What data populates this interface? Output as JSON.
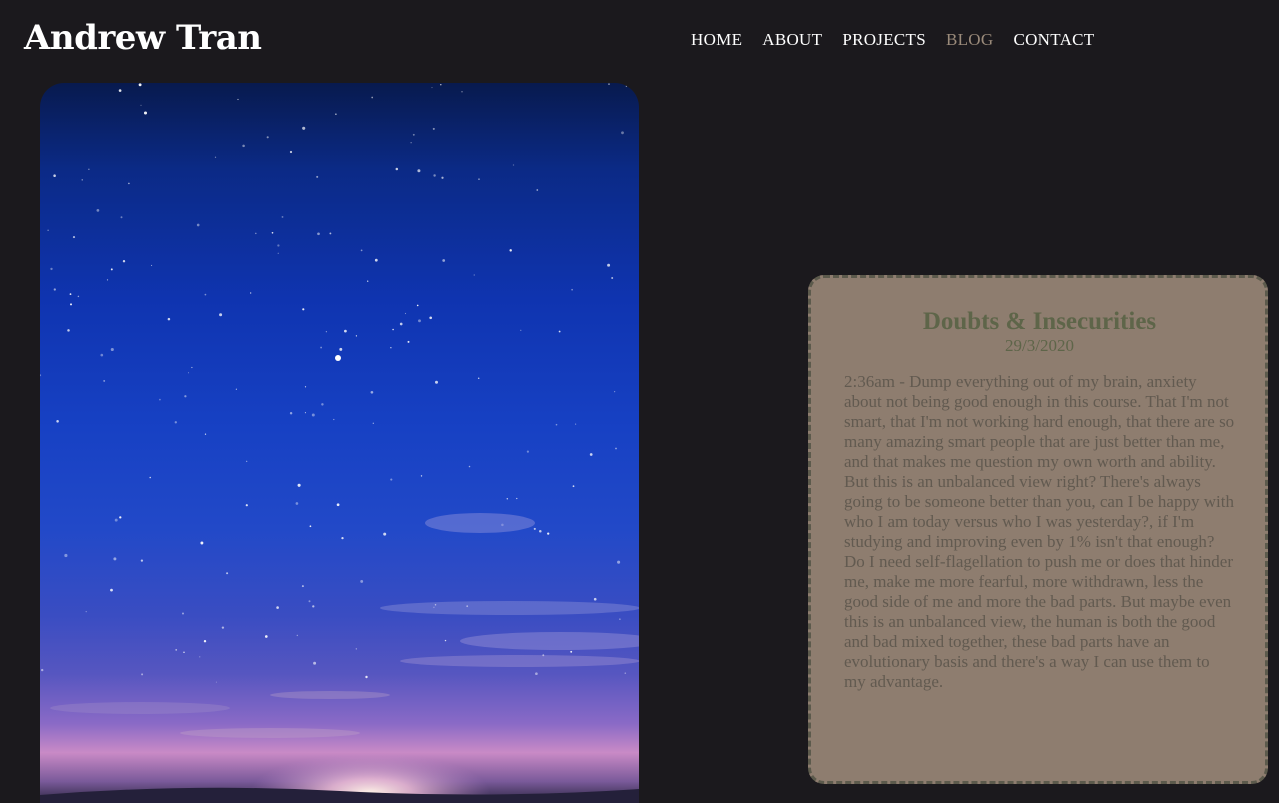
{
  "site": {
    "title": "Andrew Tran"
  },
  "nav": {
    "items": [
      {
        "label": "HOME",
        "active": false
      },
      {
        "label": "ABOUT",
        "active": false
      },
      {
        "label": "PROJECTS",
        "active": false
      },
      {
        "label": "BLOG",
        "active": true
      },
      {
        "label": "CONTACT",
        "active": false
      }
    ]
  },
  "post": {
    "title": "Doubts & Insecurities",
    "date": "29/3/2020",
    "body": "2:36am - Dump everything out of my brain, anxiety about not being good enough in this course. That I'm not smart, that I'm not working hard enough, that there are so many amazing smart people that are just better than me, and that makes me question my own worth and ability. But this is an unbalanced view right? There's always going to be someone better than you, can I be happy with who I am today versus who I was yesterday?, if I'm studying and improving even by 1% isn't that enough? Do I need self-flagellation to push me or does that hinder me, make me more fearful, more withdrawn, less the good side of me and more the bad parts. But maybe even this is an unbalanced view, the human is both the good and bad mixed together, these bad parts have an evolutionary basis and there's a way I can use them to my advantage."
  },
  "colors": {
    "background": "#1b191d",
    "nav_active": "#9a8a7a",
    "card_bg": "#8e7d6f",
    "card_border": "#5c5a4c",
    "title_color": "#5e6549"
  },
  "hero_image": {
    "description_icon": "night-sky-image"
  }
}
